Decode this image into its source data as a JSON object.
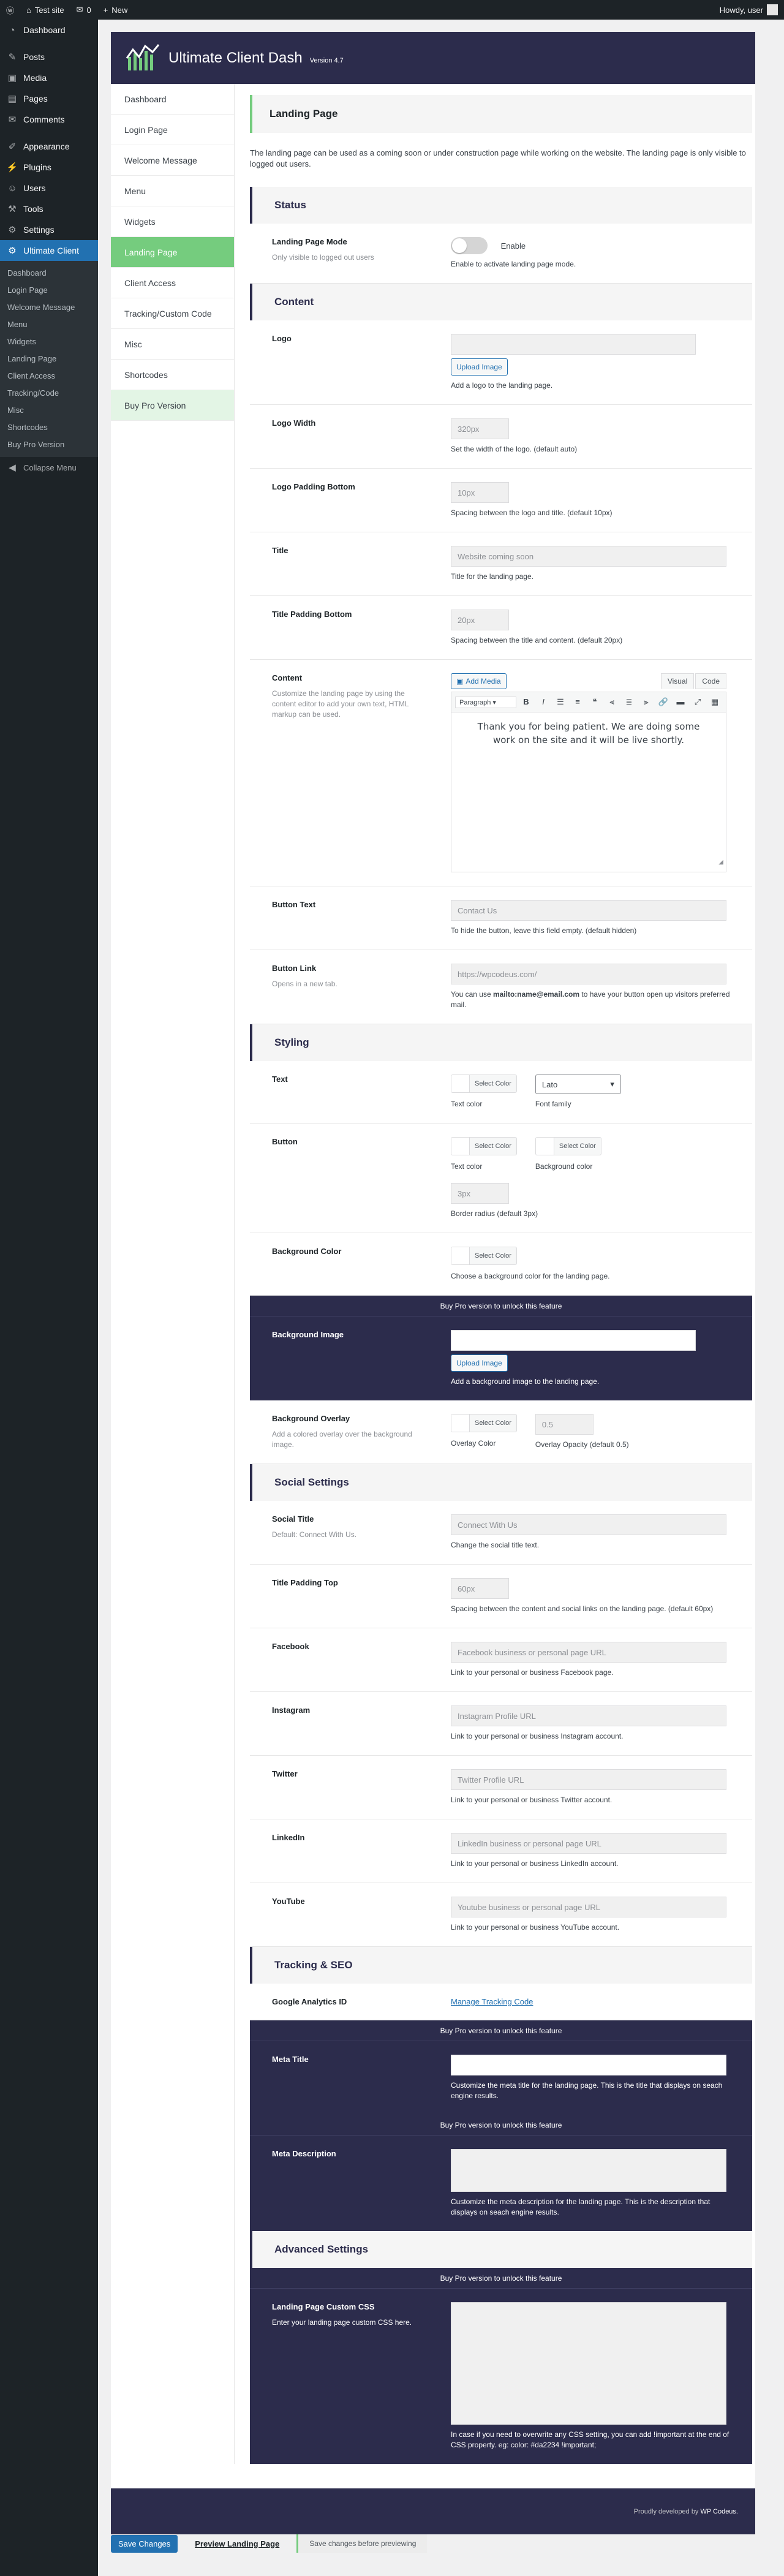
{
  "adminbar": {
    "site_name": "Test site",
    "comments_count": "0",
    "new_label": "New",
    "howdy": "Howdy, user"
  },
  "menu": {
    "dashboard": "Dashboard",
    "posts": "Posts",
    "media": "Media",
    "pages": "Pages",
    "comments": "Comments",
    "appearance": "Appearance",
    "plugins": "Plugins",
    "users": "Users",
    "tools": "Tools",
    "settings": "Settings",
    "ultimate_client": "Ultimate Client",
    "submenu": [
      "Dashboard",
      "Login Page",
      "Welcome Message",
      "Menu",
      "Widgets",
      "Landing Page",
      "Client Access",
      "Tracking/Code",
      "Misc",
      "Shortcodes",
      "Buy Pro Version"
    ],
    "collapse": "Collapse Menu"
  },
  "header": {
    "title": "Ultimate Client Dash",
    "version": "Version 4.7"
  },
  "tabs": [
    "Dashboard",
    "Login Page",
    "Welcome Message",
    "Menu",
    "Widgets",
    "Landing Page",
    "Client Access",
    "Tracking/Custom Code",
    "Misc",
    "Shortcodes",
    "Buy Pro Version"
  ],
  "page": {
    "title": "Landing Page",
    "intro": "The landing page can be used as a coming soon or under construction page while working on the website. The landing page is only visible to logged out users."
  },
  "status": {
    "heading": "Status",
    "mode_label": "Landing Page Mode",
    "mode_sub": "Only visible to logged out users",
    "toggle_text": "Enable",
    "mode_desc": "Enable to activate landing page mode."
  },
  "content": {
    "heading": "Content",
    "logo_label": "Logo",
    "upload_label": "Upload Image",
    "logo_desc": "Add a logo to the landing page.",
    "logo_width_label": "Logo Width",
    "logo_width_placeholder": "320px",
    "logo_width_desc": "Set the width of the logo. (default auto)",
    "logo_pad_label": "Logo Padding Bottom",
    "logo_pad_placeholder": "10px",
    "logo_pad_desc": "Spacing between the logo and title. (default 10px)",
    "title_label": "Title",
    "title_placeholder": "Website coming soon",
    "title_desc": "Title for the landing page.",
    "title_pad_label": "Title Padding Bottom",
    "title_pad_placeholder": "20px",
    "title_pad_desc": "Spacing between the title and content. (default 20px)",
    "content_label": "Content",
    "content_sub": "Customize the landing page by using the content editor to add your own text, HTML markup can be used.",
    "add_media": "Add Media",
    "visual_tab": "Visual",
    "code_tab": "Code",
    "paragraph": "Paragraph",
    "editor_text": "Thank you for being patient. We are doing some work on the site and it will be live shortly.",
    "button_text_label": "Button Text",
    "button_text_placeholder": "Contact Us",
    "button_text_desc": "To hide the button, leave this field empty. (default hidden)",
    "button_link_label": "Button Link",
    "button_link_sub": "Opens in a new tab.",
    "button_link_placeholder": "https://wpcodeus.com/",
    "button_link_desc_pre": "You can use ",
    "button_link_desc_bold": "mailto:name@email.com",
    "button_link_desc_post": " to have your button open up visitors preferred mail."
  },
  "styling": {
    "heading": "Styling",
    "select_color": "Select Color",
    "text_label": "Text",
    "text_color": "Text color",
    "font_value": "Lato",
    "font_family": "Font family",
    "button_label": "Button",
    "bg_color_caption": "Background color",
    "radius_placeholder": "3px",
    "radius_desc": "Border radius (default 3px)",
    "bgc_label": "Background Color",
    "bgc_desc": "Choose a background color for the landing page.",
    "pro_banner": "Buy Pro version to unlock this feature",
    "bg_image_label": "Background Image",
    "bg_image_desc": "Add a background image to the landing page.",
    "overlay_label": "Background Overlay",
    "overlay_sub": "Add a colored overlay over the background image.",
    "overlay_color": "Overlay Color",
    "overlay_opacity_placeholder": "0.5",
    "overlay_opacity": "Overlay Opacity (default 0.5)"
  },
  "social": {
    "heading": "Social Settings",
    "title_label": "Social Title",
    "title_sub": "Default: Connect With Us.",
    "title_placeholder": "Connect With Us",
    "title_desc": "Change the social title text.",
    "pad_label": "Title Padding Top",
    "pad_placeholder": "60px",
    "pad_desc": "Spacing between the content and social links on the landing page. (default 60px)",
    "facebook_label": "Facebook",
    "facebook_placeholder": "Facebook business or personal page URL",
    "facebook_desc": "Link to your personal or business Facebook page.",
    "instagram_label": "Instagram",
    "instagram_placeholder": "Instagram Profile URL",
    "instagram_desc": "Link to your personal or business Instagram account.",
    "twitter_label": "Twitter",
    "twitter_placeholder": "Twitter Profile URL",
    "twitter_desc": "Link to your personal or business Twitter account.",
    "linkedin_label": "LinkedIn",
    "linkedin_placeholder": "LinkedIn business or personal page URL",
    "linkedin_desc": "Link to your personal or business LinkedIn account.",
    "youtube_label": "YouTube",
    "youtube_placeholder": "Youtube business or personal page URL",
    "youtube_desc": "Link to your personal or business YouTube account."
  },
  "tracking": {
    "heading": "Tracking & SEO",
    "ga_label": "Google Analytics ID",
    "ga_link": "Manage Tracking Code",
    "pro_banner": "Buy Pro version to unlock this feature",
    "meta_title_label": "Meta Title",
    "meta_title_desc": "Customize the meta title for the landing page. This is the title that displays on seach engine results.",
    "meta_desc_label": "Meta Description",
    "meta_desc_desc": "Customize the meta description for the landing page. This is the description that displays on seach engine results."
  },
  "advanced": {
    "heading": "Advanced Settings",
    "pro_banner": "Buy Pro version to unlock this feature",
    "css_label": "Landing Page Custom CSS",
    "css_sub": "Enter your landing page custom CSS here.",
    "css_desc": "In case if you need to overwrite any CSS setting, you can add !important at the end of CSS property. eg: color: #da2234 !important;"
  },
  "footer": {
    "text": "Proudly developed by",
    "brand": "WP Codeus."
  },
  "bottom": {
    "save": "Save Changes",
    "preview": "Preview Landing Page",
    "notice": "Save changes before previewing"
  },
  "colors": {
    "accent_green": "#75cc7e",
    "navy": "#2c2c4c",
    "wp_blue": "#2271b1",
    "admin_dark": "#1d2327"
  }
}
